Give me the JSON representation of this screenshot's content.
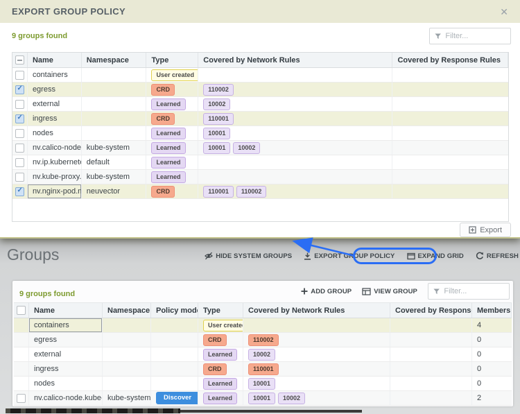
{
  "modal": {
    "title": "EXPORT GROUP POLICY",
    "close_icon": "✕",
    "count_text": "9 groups found",
    "filter_placeholder": "Filter...",
    "header_checkbox": "indeterminate",
    "columns": [
      "Name",
      "Namespace",
      "Type",
      "Covered by Network Rules",
      "Covered by Response Rules"
    ],
    "rows": [
      {
        "name": "containers",
        "namespace": "",
        "type": "User created",
        "type_style": "user",
        "network_rules": [],
        "checkbox": "unchecked",
        "selected": false
      },
      {
        "name": "egress",
        "namespace": "",
        "type": "CRD",
        "type_style": "crd",
        "network_rules": [
          "110002"
        ],
        "checkbox": "checked",
        "selected": true
      },
      {
        "name": "external",
        "namespace": "",
        "type": "Learned",
        "type_style": "learned",
        "network_rules": [
          "10002"
        ],
        "checkbox": "unchecked",
        "selected": false
      },
      {
        "name": "ingress",
        "namespace": "",
        "type": "CRD",
        "type_style": "crd",
        "network_rules": [
          "110001"
        ],
        "checkbox": "checked",
        "selected": true
      },
      {
        "name": "nodes",
        "namespace": "",
        "type": "Learned",
        "type_style": "learned",
        "network_rules": [
          "10001"
        ],
        "checkbox": "unchecked",
        "selected": false
      },
      {
        "name": "nv.calico-node.kub",
        "namespace": "kube-system",
        "type": "Learned",
        "type_style": "learned",
        "network_rules": [
          "10001",
          "10002"
        ],
        "checkbox": "unchecked",
        "selected": false
      },
      {
        "name": "nv.ip.kubernetes.d",
        "namespace": "default",
        "type": "Learned",
        "type_style": "learned",
        "network_rules": [],
        "checkbox": "unchecked",
        "selected": false
      },
      {
        "name": "nv.kube-proxy.kub",
        "namespace": "kube-system",
        "type": "Learned",
        "type_style": "learned",
        "network_rules": [],
        "checkbox": "unchecked",
        "selected": false
      },
      {
        "name": "nv.nginx-pod.neuv",
        "namespace": "neuvector",
        "type": "CRD",
        "type_style": "crd",
        "network_rules": [
          "110001",
          "110002"
        ],
        "checkbox": "checked",
        "selected": true,
        "focused": true
      }
    ],
    "export_label": "Export"
  },
  "page": {
    "heading": "Groups",
    "toolbar": [
      {
        "label": "HIDE SYSTEM GROUPS",
        "icon": "eye-off-icon"
      },
      {
        "label": "EXPORT GROUP POLICY",
        "icon": "download-icon",
        "annotated": true
      },
      {
        "label": "EXPAND GRID",
        "icon": "expand-icon"
      },
      {
        "label": "REFRESH",
        "icon": "refresh-icon"
      }
    ],
    "count_text": "9 groups found",
    "actions": [
      {
        "label": "ADD GROUP",
        "icon": "plus-icon"
      },
      {
        "label": "VIEW GROUP",
        "icon": "grid-icon"
      }
    ],
    "filter_placeholder": "Filter...",
    "header_checkbox": "unchecked",
    "columns": [
      "Name",
      "Namespace",
      "Policy mode",
      "Type",
      "Covered by Network Rules",
      "Covered by Response R..",
      "Members"
    ],
    "rows": [
      {
        "name": "containers",
        "namespace": "",
        "policy_mode": "",
        "type": "User created",
        "type_style": "user",
        "network_rules": [],
        "rule_style": "lavender",
        "members": "4",
        "checkbox": "none",
        "selected": true,
        "focused": true
      },
      {
        "name": "egress",
        "namespace": "",
        "policy_mode": "",
        "type": "CRD",
        "type_style": "crd",
        "network_rules": [
          "110002"
        ],
        "rule_style": "salmon",
        "members": "0",
        "checkbox": "none",
        "selected": false
      },
      {
        "name": "external",
        "namespace": "",
        "policy_mode": "",
        "type": "Learned",
        "type_style": "learned",
        "network_rules": [
          "10002"
        ],
        "rule_style": "lavender",
        "members": "0",
        "checkbox": "none",
        "selected": false
      },
      {
        "name": "ingress",
        "namespace": "",
        "policy_mode": "",
        "type": "CRD",
        "type_style": "crd",
        "network_rules": [
          "110001"
        ],
        "rule_style": "salmon",
        "members": "0",
        "checkbox": "none",
        "selected": false
      },
      {
        "name": "nodes",
        "namespace": "",
        "policy_mode": "",
        "type": "Learned",
        "type_style": "learned",
        "network_rules": [
          "10001"
        ],
        "rule_style": "lavender",
        "members": "0",
        "checkbox": "none",
        "selected": false
      },
      {
        "name": "nv.calico-node.kube-sys",
        "namespace": "kube-system",
        "policy_mode": "Discover",
        "type": "Learned",
        "type_style": "learned",
        "network_rules": [
          "10001",
          "10002"
        ],
        "rule_style": "lavender",
        "members": "2",
        "checkbox": "unchecked",
        "selected": false
      }
    ]
  },
  "annotation": {
    "arrow_color": "#2a6df4"
  },
  "colors": {
    "header_olive": "#e9e9d5",
    "accent_green": "#7d9b2f",
    "selected_row": "#f0f1da",
    "crd_badge": "#f6a98d",
    "learned_badge": "#e4d8f3",
    "user_badge": "#fffce4",
    "discover_blue": "#3d8ede"
  }
}
